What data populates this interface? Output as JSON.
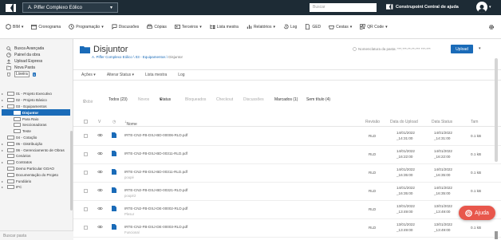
{
  "topbar": {
    "project": "A. Piffer Complexo Eólico",
    "search_placeholder": "Buscar",
    "brand": "Construpoint",
    "help": "Central de ajuda"
  },
  "toolbar": {
    "items": [
      "BIM",
      "Cronograma",
      "Programação",
      "Discussões",
      "Cópias",
      "Terceiros",
      "Lista mestra",
      "Relatórios",
      "Log",
      "GED",
      "Cestas",
      "QR Code"
    ]
  },
  "sidebar": {
    "links": [
      "Busca Avançada",
      "Painel da obra",
      "Upload Express",
      "Nova Pasta",
      "Lixeira"
    ],
    "lixeira_count": "1",
    "tree": [
      {
        "label": "01 - Projeto Executivo",
        "level": 0,
        "caret": "▸"
      },
      {
        "label": "02 - Projeto Básico",
        "level": 0,
        "caret": "▸"
      },
      {
        "label": "03 - Equipamentos",
        "level": 0,
        "caret": "▾"
      },
      {
        "label": "Disjuntor",
        "level": 1,
        "caret": "",
        "selected": true
      },
      {
        "label": "Para Raio",
        "level": 1,
        "caret": ""
      },
      {
        "label": "Seccionadoras",
        "level": 1,
        "caret": ""
      },
      {
        "label": "Teste",
        "level": 1,
        "caret": ""
      },
      {
        "label": "04 - Cotação",
        "level": 0,
        "caret": ""
      },
      {
        "label": "05 - Distribuição",
        "level": 0,
        "caret": "▸"
      },
      {
        "label": "06 - Gerenciamento de Obras",
        "level": 0,
        "caret": "▸"
      },
      {
        "label": "Cenários",
        "level": 0,
        "caret": ""
      },
      {
        "label": "Contratos",
        "level": 0,
        "caret": "▸"
      },
      {
        "label": "Demo Particular GOAO",
        "level": 0,
        "caret": ""
      },
      {
        "label": "Documentação do Projeto",
        "level": 0,
        "caret": ""
      },
      {
        "label": "Fundiário",
        "level": 0,
        "caret": "▸"
      },
      {
        "label": "IFC",
        "level": 0,
        "caret": "▸"
      }
    ],
    "search_placeholder": "Buscar pasta"
  },
  "main": {
    "title": "Disjuntor",
    "breadcrumb": "A. Piffer Complexo Eólico",
    "breadcrumb_mid": "03 - Equipamentos",
    "breadcrumb_current": "Disjuntor",
    "email_label": "Nomenclatura da pasta: ***.***-**-**-*** ***-***",
    "upload": "Upload",
    "actions": [
      "Ações",
      "Alterar Status",
      "Lista mestra",
      "Log"
    ],
    "filters": {
      "exibir": "Exibir",
      "todos": "Todos (23)",
      "novos": "Novos",
      "status": "Status",
      "bloqueados": "Bloqueados",
      "checkout": "Checkout",
      "discussoes": "Discussões",
      "marcados": "Marcados (1)",
      "sem_titulo": "Sem título (4)"
    },
    "columns": {
      "v": "V",
      "nome": "Nome",
      "revisao": "Revisão",
      "data_upload": "Data do Upload",
      "data_status": "Data Status",
      "tam": "Tam"
    },
    "rows": [
      {
        "name": "IRTE-CN2-FB-DSJ-BD-00006-RLD.pdf",
        "sub": "",
        "rev": "RLD",
        "up1": "14/01/2022",
        "up2": "_14:31:00",
        "st1": "14/01/2022",
        "st2": "_14:31:00",
        "size": "0.1 kB"
      },
      {
        "name": "IRTE-CN2-FB-DSJ-BD-00311-RLD.pdf",
        "sub": "",
        "rev": "RLD",
        "up1": "14/01/2022",
        "up2": "_16:22:00",
        "st1": "14/01/2022",
        "st2": "_16:22:00",
        "size": "0.1 kB"
      },
      {
        "name": "IRTE-CN2-FB-DSJ-BD-00311-RLD.pdf",
        "sub": "poupé",
        "rev": "RLD",
        "up1": "14/01/2022",
        "up2": "_16:35:00",
        "st1": "14/01/2022",
        "st2": "_16:35:00",
        "size": "0.1 kB"
      },
      {
        "name": "IRTE-CN2-FB-DSJ-BD-00321-RLD.pdf",
        "sub": "poupé2",
        "rev": "RLD",
        "up1": "14/01/2022",
        "up2": "_16:35:00",
        "st1": "14/01/2022",
        "st2": "_16:35:00",
        "size": "0.1 kB"
      },
      {
        "name": "IRTE-CN2-FB-DSJ-DE-00002-RLD.pdf",
        "sub": "Plesur",
        "rev": "RLD",
        "up1": "13/01/2022",
        "up2": "_13:49:00",
        "st1": "13/01/2022",
        "st2": "_13:49:00",
        "size": "0.1 kB"
      },
      {
        "name": "IRTE-CN2-FB-DSJ-DE-00003-RLD.pdf",
        "sub": "Funcional",
        "rev": "RLD",
        "up1": "13/01/2022",
        "up2": "_13:49:00",
        "st1": "13/01/2022",
        "st2": "_13:49:00",
        "size": "0.1 kB"
      }
    ]
  },
  "help_button": "Ajuda",
  "colors": {
    "topbar": "#1d2b35",
    "accent": "#1a6bb8",
    "help": "#e8574c"
  }
}
